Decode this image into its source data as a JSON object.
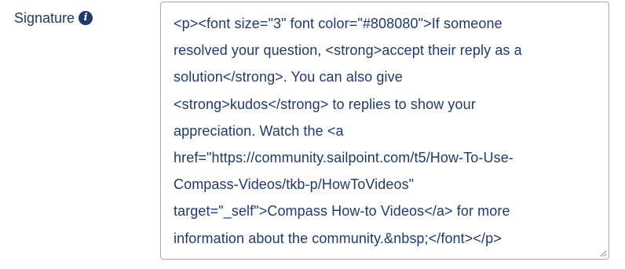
{
  "field": {
    "label": "Signature",
    "info_icon": "info-circle-icon",
    "value": "<p><font size=\"3\" font color=\"#808080\">If someone\nresolved your question, <strong>accept their reply as a\nsolution</strong>. You can also give\n<strong>kudos</strong> to replies to show your\nappreciation. Watch the <a\nhref=\"https://community.sailpoint.com/t5/How-To-Use-\nCompass-Videos/tkb-p/HowToVideos\"\ntarget=\"_self\">Compass How-to Videos</a> for more\ninformation about the community.&nbsp;</font></p>"
  },
  "colors": {
    "text": "#1f3a6e",
    "border": "#a9a9a9"
  }
}
